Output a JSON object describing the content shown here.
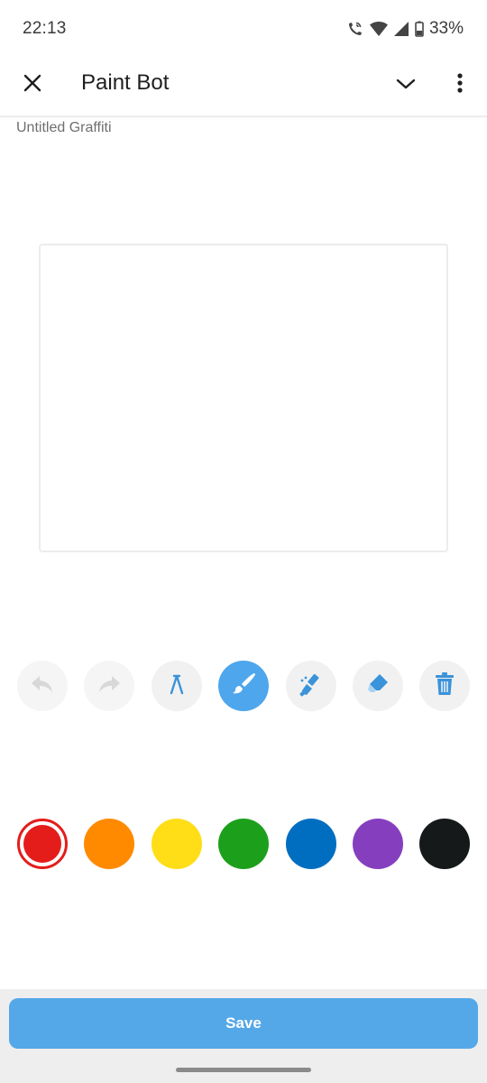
{
  "status_bar": {
    "time": "22:13",
    "battery_percent": "33%",
    "icons": [
      "wifi-calling-icon",
      "wifi-icon",
      "cellular-signal-icon",
      "battery-icon"
    ]
  },
  "app_bar": {
    "title": "Paint Bot",
    "icons": [
      "close-icon",
      "chevron-down-icon",
      "more-vert-icon"
    ]
  },
  "document": {
    "name": "Untitled Graffiti"
  },
  "tools": [
    {
      "name": "undo",
      "icon": "undo-icon",
      "state": "disabled"
    },
    {
      "name": "redo",
      "icon": "redo-icon",
      "state": "disabled"
    },
    {
      "name": "pen",
      "icon": "pen-nib-icon",
      "state": "normal"
    },
    {
      "name": "brush",
      "icon": "paint-brush-icon",
      "state": "active"
    },
    {
      "name": "spray",
      "icon": "spray-brush-icon",
      "state": "normal"
    },
    {
      "name": "eraser",
      "icon": "eraser-icon",
      "state": "normal"
    },
    {
      "name": "clear",
      "icon": "trash-icon",
      "state": "normal"
    }
  ],
  "palette": {
    "selected": "#e41d1b",
    "colors": [
      "#e41d1b",
      "#ff8a00",
      "#ffdd17",
      "#1ca01c",
      "#006ec0",
      "#853fbe",
      "#15191a"
    ]
  },
  "accent": "#4ea6ec",
  "footer": {
    "save_label": "Save"
  }
}
